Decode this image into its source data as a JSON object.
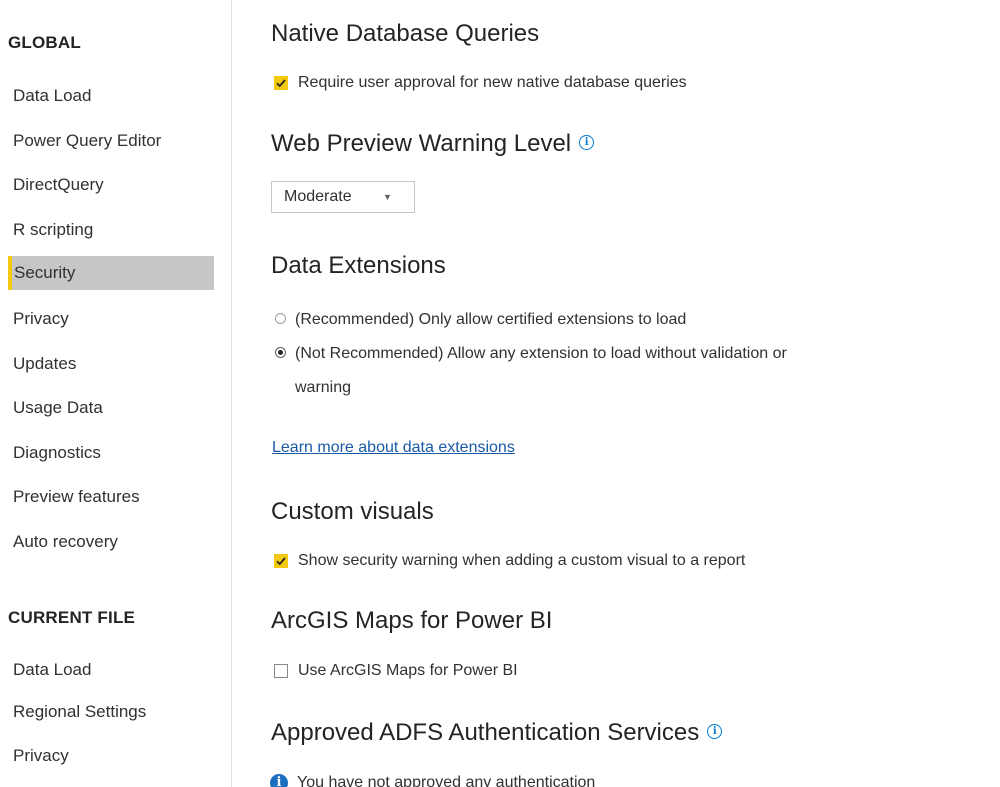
{
  "sidebar": {
    "global_header": "GLOBAL",
    "global_items": [
      {
        "label": "Data Load"
      },
      {
        "label": "Power Query Editor"
      },
      {
        "label": "DirectQuery"
      },
      {
        "label": "R scripting"
      },
      {
        "label": "Security",
        "selected": true
      },
      {
        "label": "Privacy"
      },
      {
        "label": "Updates"
      },
      {
        "label": "Usage Data"
      },
      {
        "label": "Diagnostics"
      },
      {
        "label": "Preview features"
      },
      {
        "label": "Auto recovery"
      }
    ],
    "current_file_header": "CURRENT FILE",
    "current_file_items": [
      {
        "label": "Data Load"
      },
      {
        "label": "Regional Settings"
      },
      {
        "label": "Privacy"
      }
    ]
  },
  "main": {
    "native_db": {
      "title": "Native Database Queries",
      "checkbox_label": "Require user approval for new native database queries",
      "checked": true
    },
    "web_preview": {
      "title": "Web Preview Warning Level",
      "info_icon": "info-icon",
      "dropdown_value": "Moderate"
    },
    "data_extensions": {
      "title": "Data Extensions",
      "option_recommended": "(Recommended) Only allow certified extensions to load",
      "option_not_recommended": "(Not Recommended) Allow any extension to load without validation or",
      "option_not_recommended_cont": "warning",
      "selected_option": "not_recommended",
      "learn_more_link": "Learn more about data extensions"
    },
    "custom_visuals": {
      "title": "Custom visuals",
      "checkbox_label": "Show security warning when adding a custom visual to a report",
      "checked": true
    },
    "arcgis": {
      "title": "ArcGIS Maps for Power BI",
      "checkbox_label": "Use ArcGIS Maps for Power BI",
      "checked": false
    },
    "adfs": {
      "title": "Approved ADFS Authentication Services",
      "info_icon": "info-icon",
      "message": "You have not approved any authentication"
    }
  },
  "colors": {
    "accent_yellow": "#f2c811",
    "selected_bg": "#c8c6c4",
    "link_blue": "#1a5aa6",
    "info_blue": "#0078d4"
  }
}
